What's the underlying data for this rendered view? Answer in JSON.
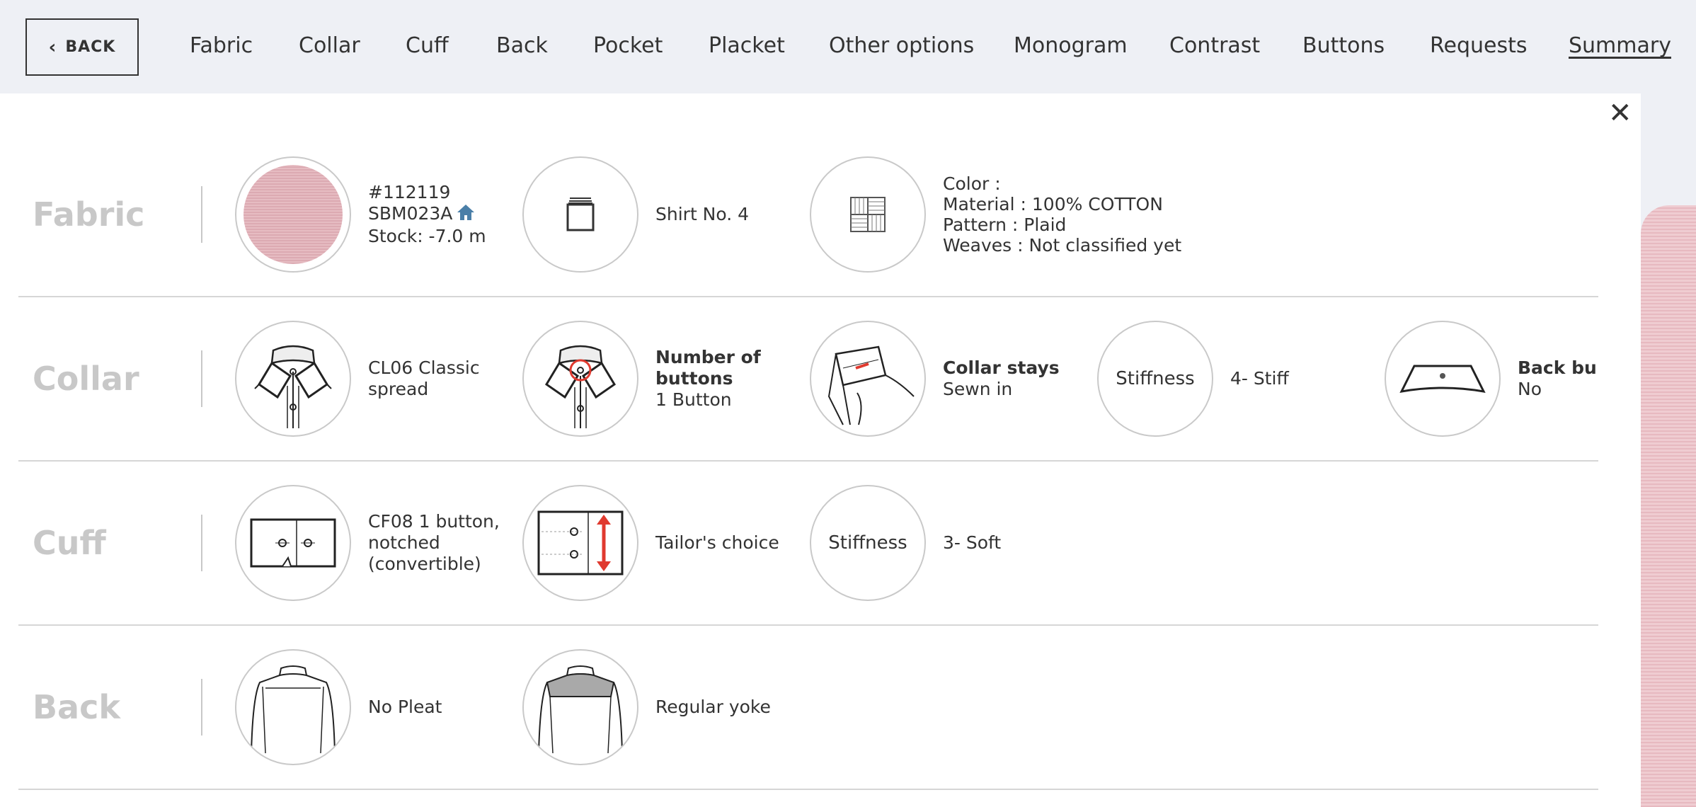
{
  "nav": {
    "back_label": "BACK",
    "tabs": [
      "Fabric",
      "Collar",
      "Cuff",
      "Back",
      "Pocket",
      "Placket",
      "Other options",
      "Monogram",
      "Contrast",
      "Buttons",
      "Requests",
      "Summary"
    ],
    "active_tab": "Summary"
  },
  "rows": {
    "fabric": {
      "title": "Fabric",
      "swatch": {
        "code": "#112119",
        "sku": "SBM023A",
        "stock": "Stock: -7.0 m"
      },
      "shirt": {
        "label": "Shirt No. 4"
      },
      "details": {
        "color": "Color :",
        "material": "Material : 100% COTTON",
        "pattern": "Pattern : Plaid",
        "weaves": "Weaves : Not classified yet"
      }
    },
    "collar": {
      "title": "Collar",
      "style": {
        "line1": "CL06 Classic",
        "line2": "spread"
      },
      "buttons": {
        "label1": "Number of",
        "label2": "buttons",
        "value": "1 Button"
      },
      "stays": {
        "label": "Collar stays",
        "value": "Sewn in"
      },
      "stiffness": {
        "circle": "Stiffness",
        "value": "4- Stiff"
      },
      "back_button": {
        "label": "Back butt",
        "value": "No"
      }
    },
    "cuff": {
      "title": "Cuff",
      "style": {
        "line1": "CF08 1 button,",
        "line2": "notched",
        "line3": "(convertible)"
      },
      "length": {
        "value": "Tailor's choice"
      },
      "stiffness": {
        "circle": "Stiffness",
        "value": "3- Soft"
      }
    },
    "back": {
      "title": "Back",
      "pleat": {
        "value": "No Pleat"
      },
      "yoke": {
        "value": "Regular yoke"
      }
    }
  },
  "colors": {
    "accent": "#4a7fa8",
    "red": "#e03a2f",
    "muted_title": "#c8c8c8"
  }
}
